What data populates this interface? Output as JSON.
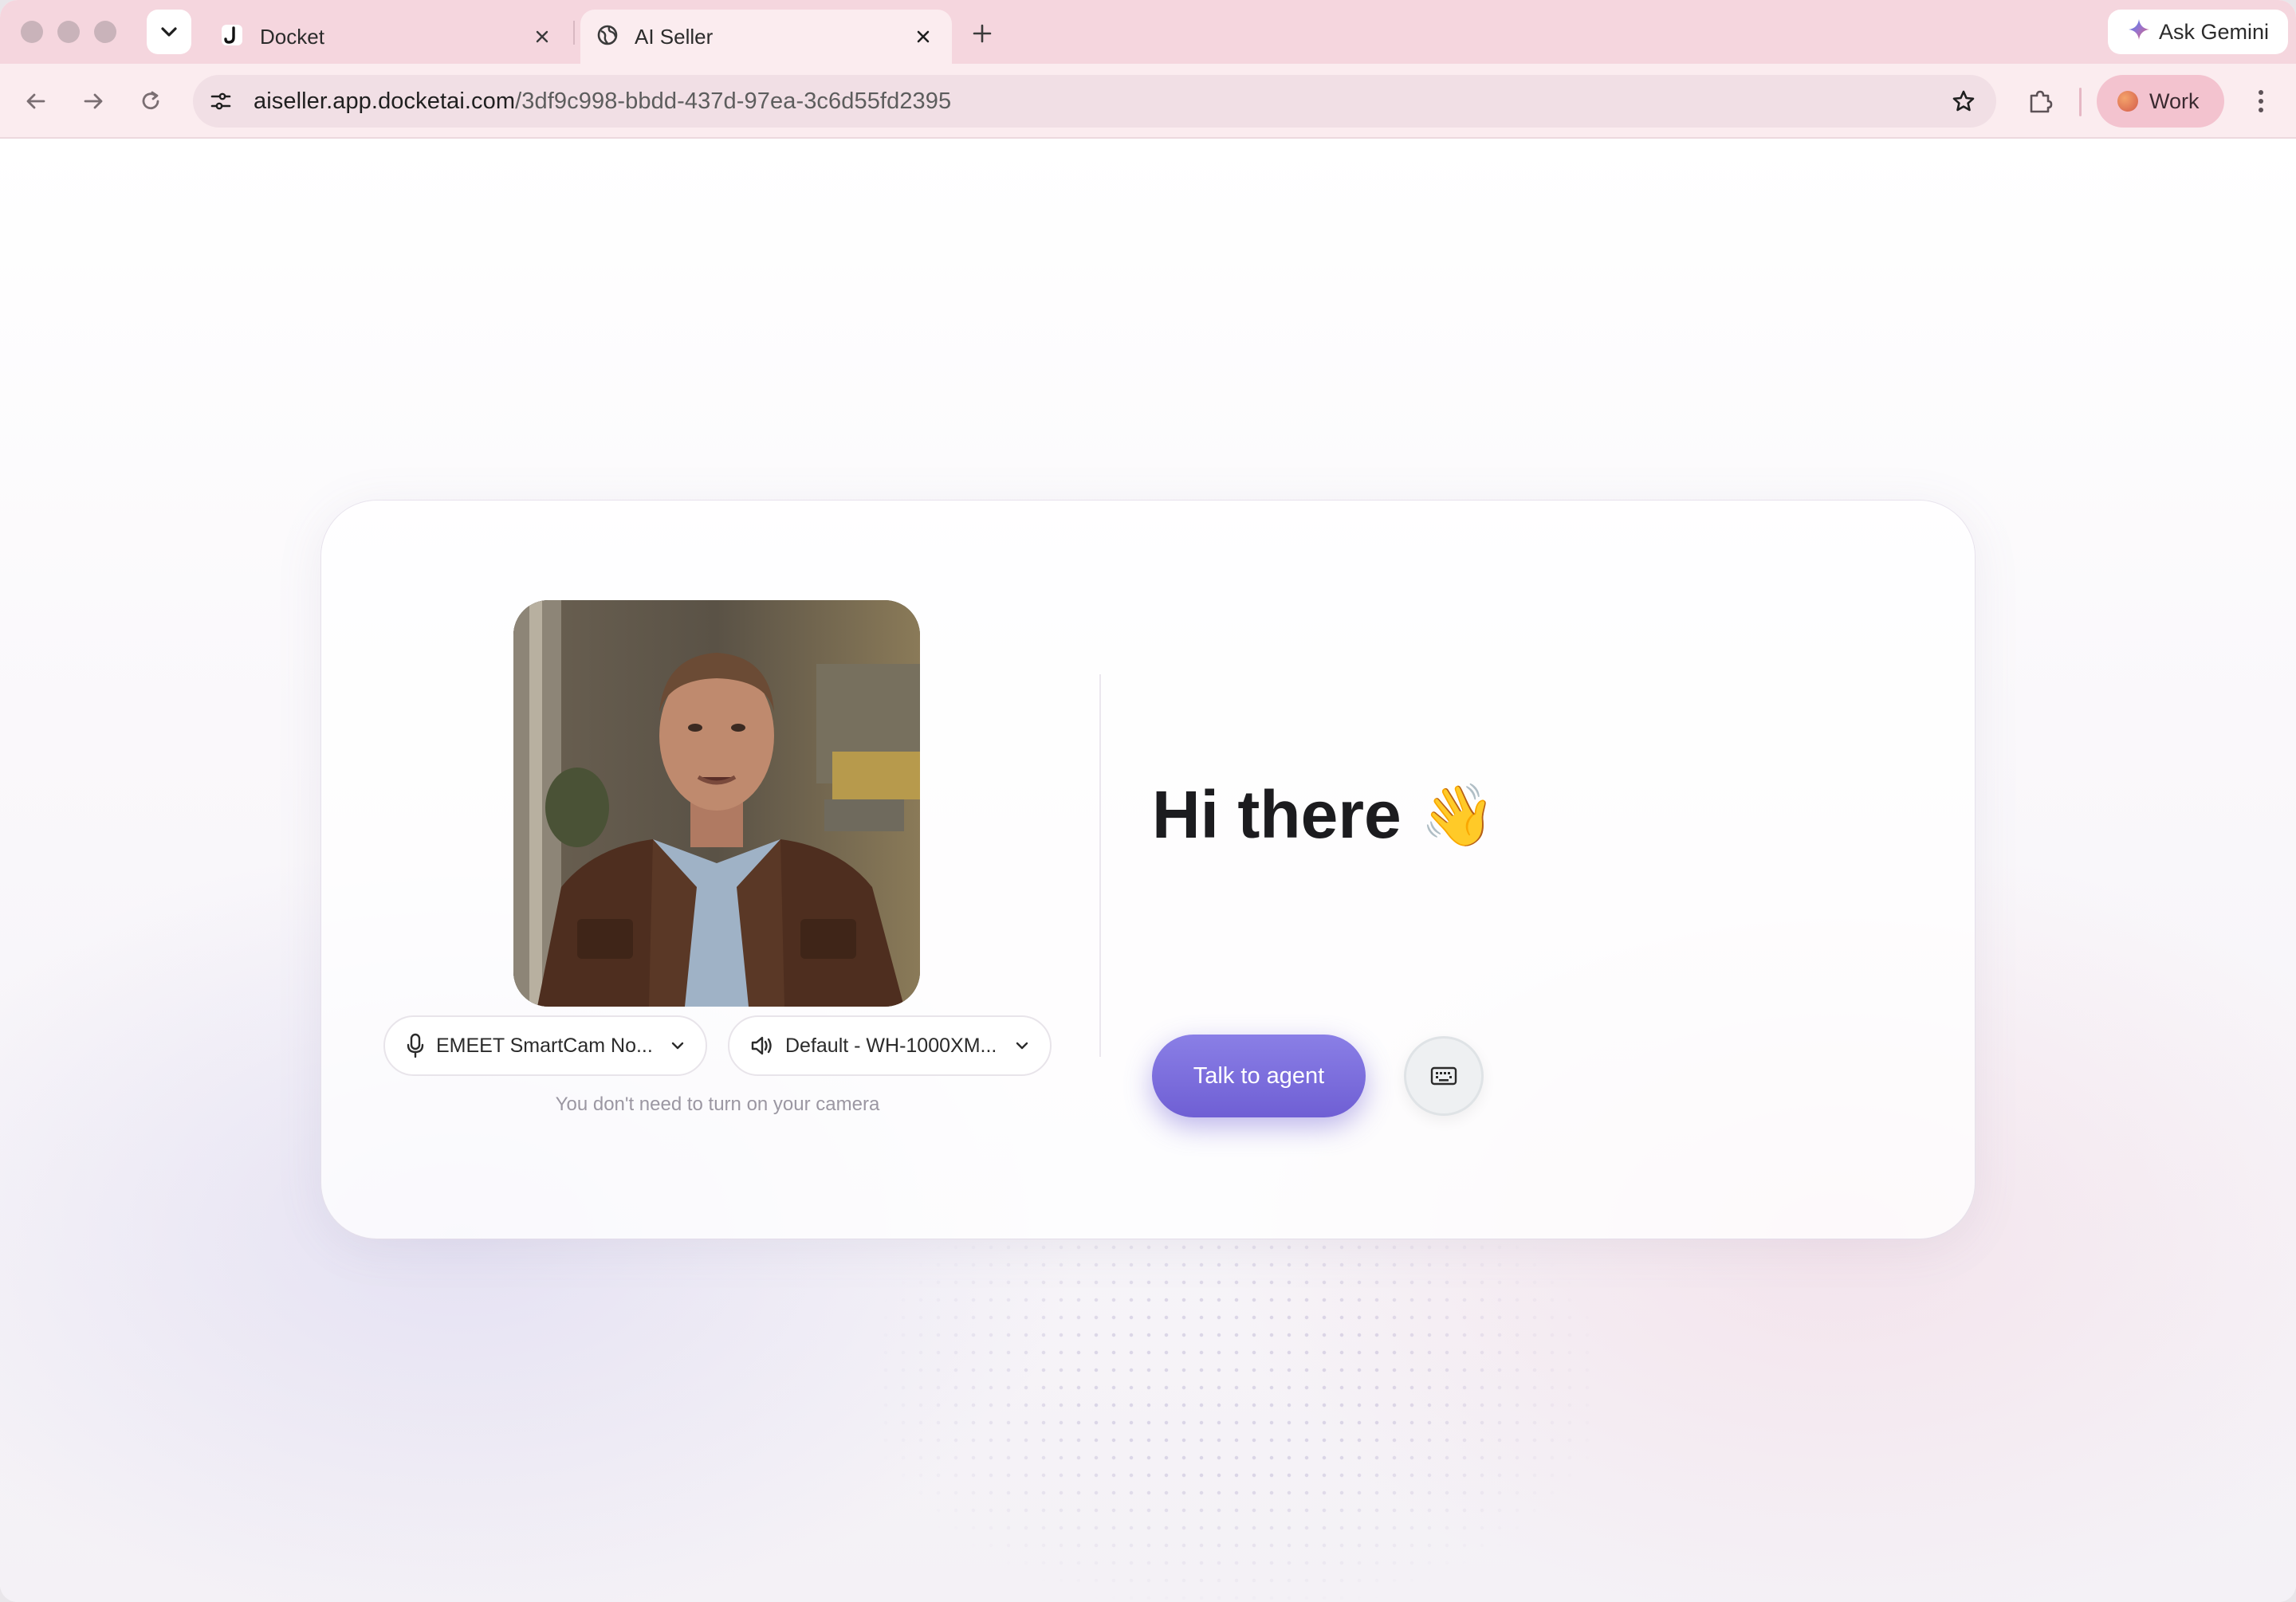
{
  "browser": {
    "tabs": [
      {
        "title": "Docket",
        "icon": "docket-logo-icon",
        "active": false
      },
      {
        "title": "AI Seller",
        "icon": "globe-icon",
        "active": true
      }
    ],
    "ask_gemini_label": "Ask Gemini",
    "url_host": "aiseller.app.docketai.com",
    "url_path": "/3df9c998-bbdd-437d-97ea-3c6d55fd2395",
    "profile_label": "Work"
  },
  "agent_card": {
    "greeting": "Hi there",
    "greeting_emoji": "👋",
    "talk_button_label": "Talk to agent",
    "mic_device_label": "EMEET SmartCam No...",
    "speaker_device_label": "Default - WH-1000XM...",
    "camera_note": "You don't need to turn on your camera"
  },
  "colors": {
    "tab_strip": "#f5d6de",
    "toolbar": "#fbecef",
    "accent": "#7a6cdc"
  }
}
